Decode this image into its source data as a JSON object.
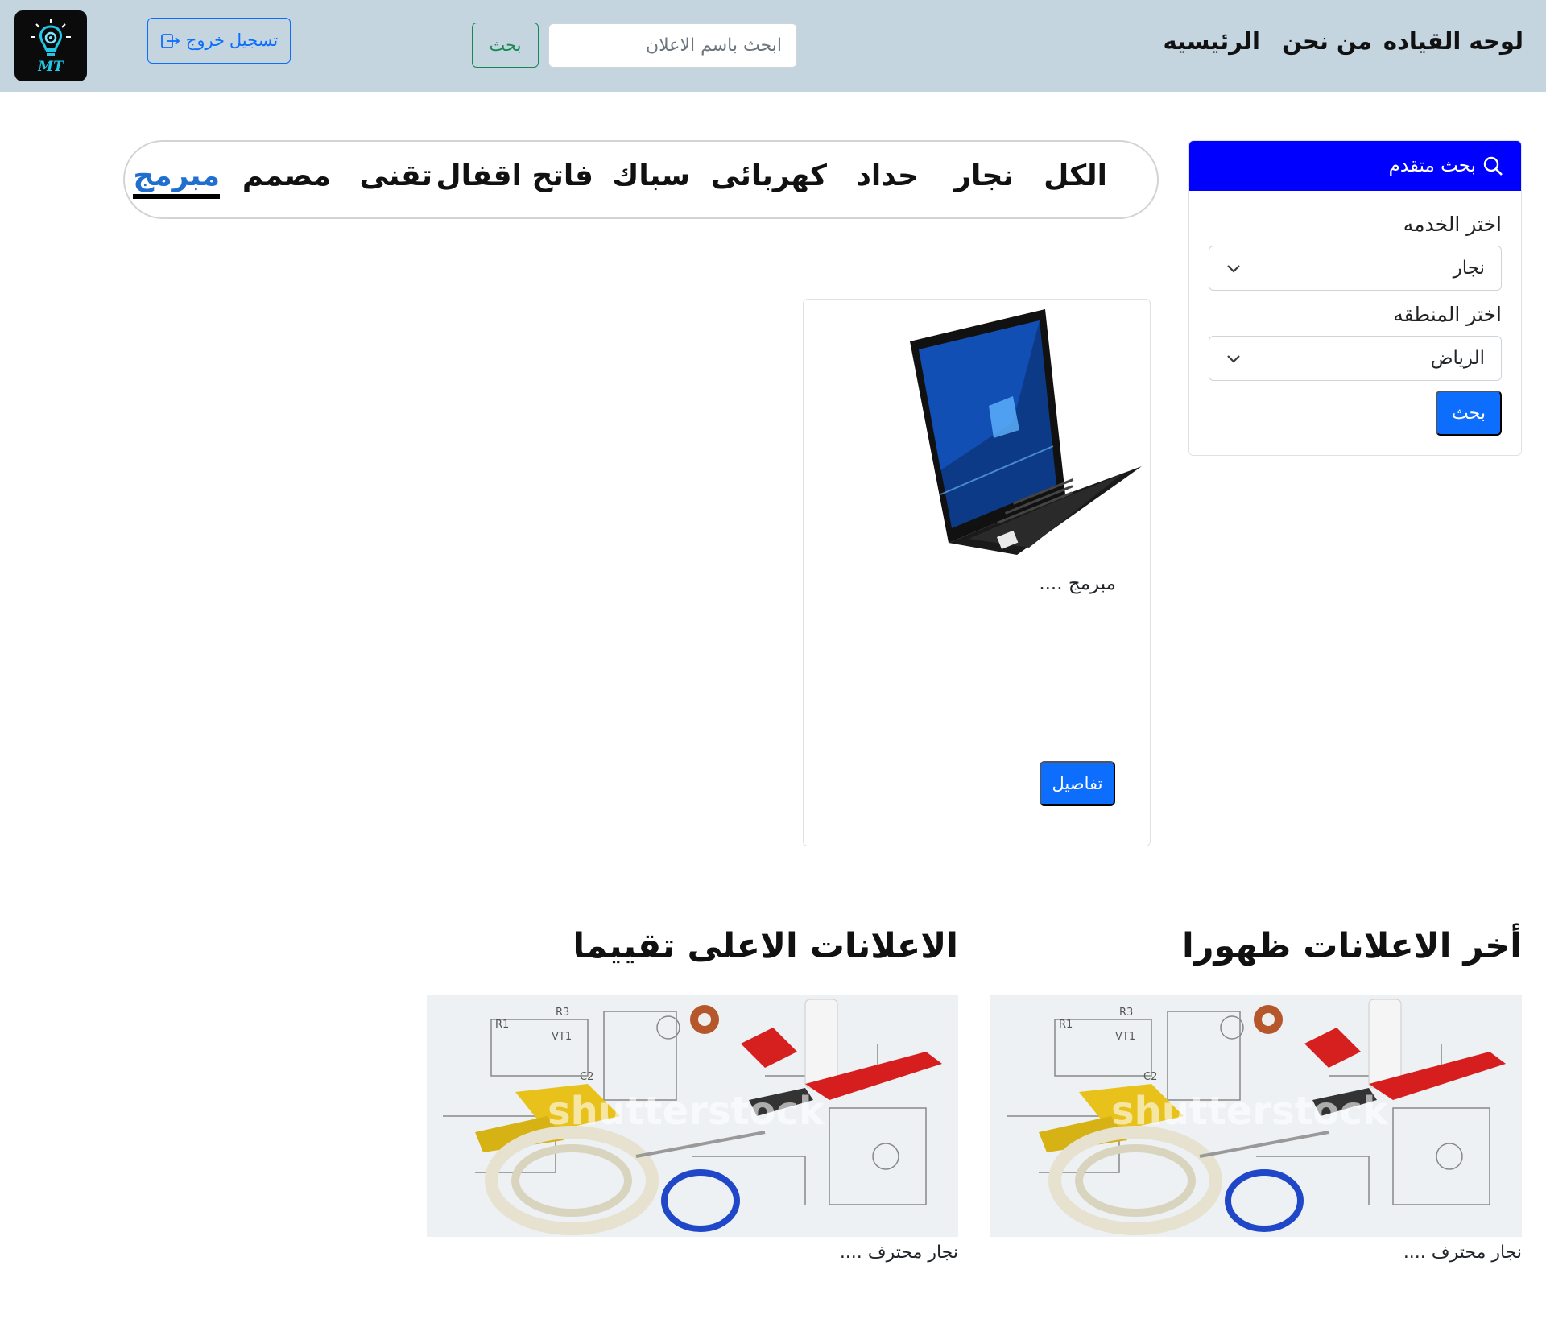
{
  "navbar": {
    "links": {
      "dashboard": "لوحه القياده",
      "about": "من نحن",
      "home": "الرئيسيه"
    },
    "search": {
      "placeholder": "ابحث باسم الاعلان",
      "button_label": "بحث"
    },
    "logout_label": "تسجيل خروج",
    "logo_text": "MT"
  },
  "advanced_search": {
    "title": "بحث متقدم",
    "service_label": "اختر الخدمه",
    "service_selected": "نجار",
    "region_label": "اختر المنطقه",
    "region_selected": "الرياض",
    "submit_label": "بحث"
  },
  "categories": {
    "all": "الكل",
    "carpenter": "نجار",
    "smith": "حداد",
    "electrician": "كهربائى",
    "plumber": "سباك",
    "locksmith": "فاتح اقفال",
    "technician": "تقنى",
    "designer": "مصمم",
    "programmer": "مبرمج",
    "active": "programmer"
  },
  "ad_card": {
    "text": "مبرمج ....",
    "details_label": "تفاصيل"
  },
  "sections": {
    "latest": {
      "title": "أخر الاعلانات ظهورا",
      "caption": "نجار محترف ...."
    },
    "top_rated": {
      "title": "الاعلانات الاعلى تقييما",
      "caption": "نجار محترف ...."
    },
    "watermark": "shutterstock"
  },
  "colors": {
    "navbar_bg": "#c4d5e0",
    "primary": "#0d6efd",
    "adv_header": "#0000ff",
    "success": "#198754",
    "active_tab": "#1f6fcf"
  }
}
